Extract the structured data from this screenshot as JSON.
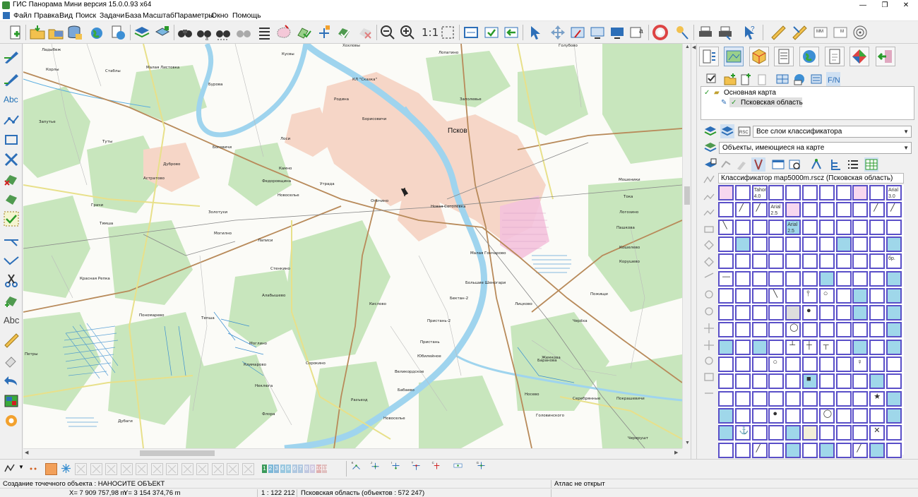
{
  "window": {
    "title": "ГИС Панорама Мини версия 15.0.0.93 x64",
    "min_symbol": "—",
    "max_symbol": "❐",
    "close_symbol": "✕"
  },
  "menu": [
    "Файл",
    "Правка",
    "Вид",
    "Поиск",
    "Задачи",
    "База",
    "Масштаб",
    "Параметры",
    "Окно",
    "Помощь"
  ],
  "toolbar": {
    "scale_1to1": "1:1"
  },
  "left_tools": {
    "abc1": "Abc",
    "abc2": "Abc"
  },
  "map": {
    "city": "Псков",
    "labels": [
      "Ладыбеж",
      "Корлы",
      "Стаблы",
      "Малая Листовка",
      "Кусвы",
      "Хохловы",
      "КЛ \"Сказка\"",
      "Лопатино",
      "Голубово",
      "Запутье",
      "Бурова",
      "Родина",
      "Борисовичи",
      "Заполевье",
      "Туты",
      "Боговичи",
      "Лоси",
      "Дуброво",
      "Камно",
      "Астратово",
      "Федоровщина",
      "Новоселье",
      "Утрада",
      "Опочино",
      "Новая Соголевка",
      "Мошеники",
      "Тока",
      "Золотухи",
      "Логозино",
      "Лаписи",
      "Пашкова",
      "Могилно",
      "Малая Гончарово",
      "Кошелево",
      "Корушево",
      "Стенкино",
      "Алабышево",
      "Кислово",
      "Большие Шеногари",
      "Бектан-2",
      "Лицково",
      "Пожищи",
      "Пономарево",
      "Тепша",
      "Черёха",
      "Петры",
      "Пристань-2",
      "Пристань",
      "Юбилейное",
      "Моглино",
      "Баранова",
      "Климарово",
      "Сорокино",
      "Великордское",
      "Бабаево",
      "Носево",
      "Неклюга",
      "Разъезд",
      "Дубаги",
      "Флора",
      "Новоселье",
      "Серебрянные",
      "Покрашевичи",
      "Черерушт",
      "Головинского",
      "Жемкова",
      "Красная Репка",
      "Грачи",
      "Тямша"
    ]
  },
  "panel": {
    "tree_root": "Основная карта",
    "tree_child": "Псковская область",
    "combo_layers": "Все слои классификатора",
    "combo_objects": "Объекты, имеющиеся на карте",
    "classifier_title": "Классификатор map5000m.rscz (Псковская область)",
    "cell_texts": {
      "tahoma": "Tahoma",
      "tahoma_size": "4.0",
      "arial_a": "Arial",
      "arial_a_size": "3.0",
      "arial_b": "Arial",
      "arial_b_size": "2.5",
      "arial_c": "Arial",
      "arial_c_size": "2.5",
      "br": "бр."
    }
  },
  "bottombar": {
    "layer_numbers": [
      "1",
      "2",
      "3",
      "4",
      "5",
      "6",
      "7",
      "8",
      "9",
      "10",
      "11"
    ]
  },
  "status": {
    "action": "Создание точечного объекта : НАНОСИТЕ ОБЪЕКТ",
    "atlas": "Атлас не открыт",
    "x": "X= 7 909 757,98 m",
    "y": "Y= 3 154 374,76 m",
    "scale": "1 : 122 212",
    "region": "Псковская область  (объектов : 572 247)"
  },
  "colors": {
    "river": "#9fd4ee",
    "forest": "#c8e6bd",
    "urban": "#f6d6c7",
    "road_main": "#b88a5a",
    "road_yellow": "#e8e08a",
    "cell_border": "#5a4fc8",
    "cell_fill": "#9fd7ea"
  }
}
